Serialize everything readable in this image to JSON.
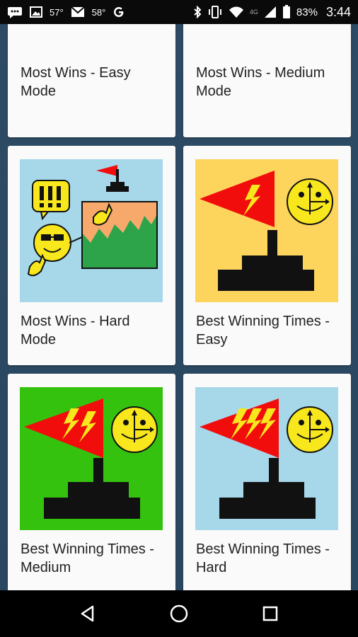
{
  "status_bar": {
    "temp1": "57°",
    "temp2": "58°",
    "battery": "83%",
    "time": "3:44",
    "network": "4G"
  },
  "achievements": [
    {
      "label": "Most Wins - Easy Mode",
      "image": "bronze-flag-yellow"
    },
    {
      "label": "Most Wins - Medium Mode",
      "image": "orange-flag-green"
    },
    {
      "label": "Most Wins - Hard Mode",
      "image": "smiley-chart-blue"
    },
    {
      "label": "Best Winning Times - Easy",
      "image": "flag-smiley-yellow"
    },
    {
      "label": "Best Winning Times - Medium",
      "image": "flag-smiley-green"
    },
    {
      "label": "Best Winning Times - Hard",
      "image": "flag-smiley-blue"
    }
  ],
  "colors": {
    "app_background": "#2b4a63",
    "card_background": "#fafafa",
    "yellow_tile": "#fdd45c",
    "green_tile": "#35c20f",
    "blue_tile": "#a6d8ea",
    "flag_red": "#f20d0d",
    "bolt_yellow": "#f8e71c"
  },
  "nav": {
    "back": "back-icon",
    "home": "home-icon",
    "recents": "recents-icon"
  }
}
